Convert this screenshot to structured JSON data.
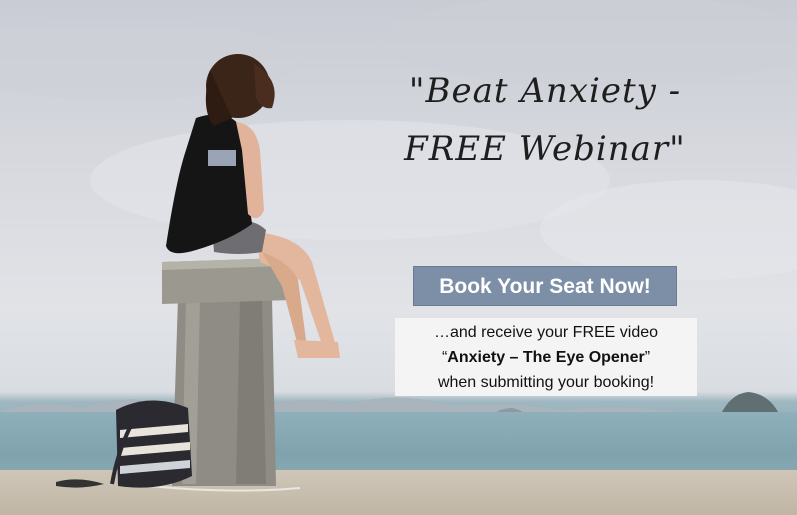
{
  "headline": {
    "line1": "\"Beat Anxiety -",
    "line2": "FREE Webinar\""
  },
  "cta": {
    "label": "Book Your Seat Now!"
  },
  "note": {
    "line1": "…and receive your FREE video",
    "quote_open": "“",
    "video_title": "Anxiety – The Eye Opener",
    "quote_close": "”",
    "line3": "when submitting your booking!"
  },
  "colors": {
    "cta_background": "#7d8fa6",
    "cta_text": "#ffffff",
    "note_background": "#f4f4f4",
    "sky": "#d6d8de",
    "sea": "#7fa3ad"
  }
}
